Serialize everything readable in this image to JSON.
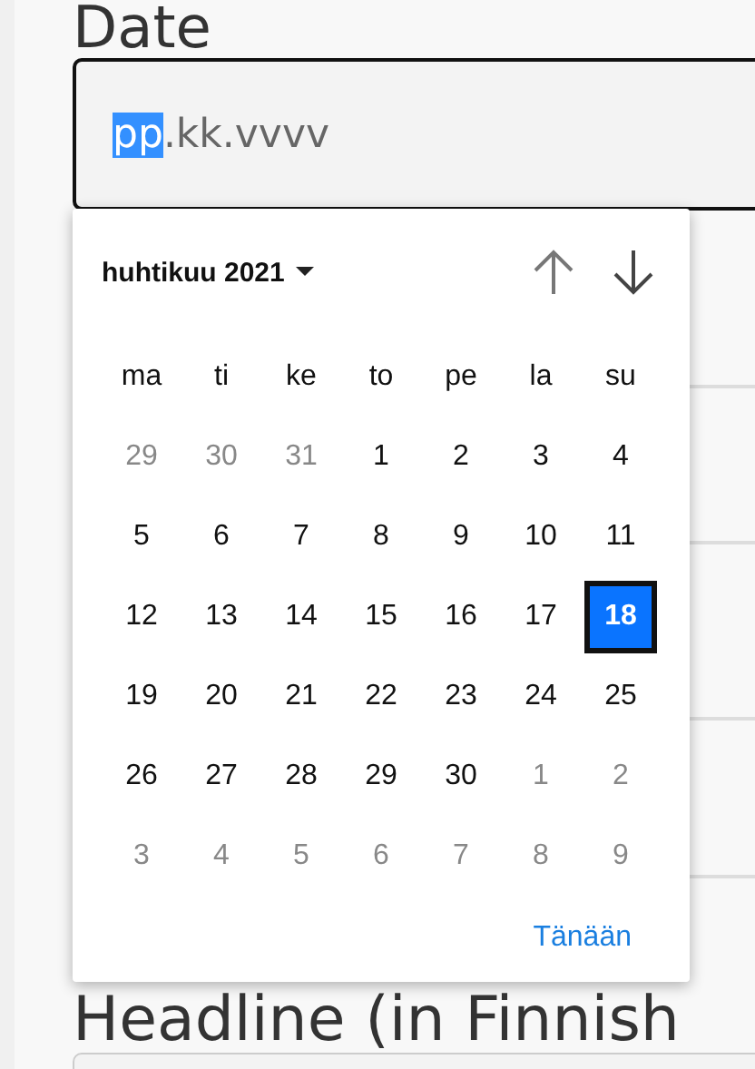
{
  "date_label": "Date",
  "date_field": {
    "segments": [
      {
        "text": "pp",
        "selected": true
      },
      {
        "text": ".kk.vvvv",
        "selected": false
      }
    ]
  },
  "calendar": {
    "month": "huhtikuu 2021",
    "weekdays": [
      "ma",
      "ti",
      "ke",
      "to",
      "pe",
      "la",
      "su"
    ],
    "weeks": [
      [
        {
          "label": "29",
          "muted": true,
          "selected": false
        },
        {
          "label": "30",
          "muted": true,
          "selected": false
        },
        {
          "label": "31",
          "muted": true,
          "selected": false
        },
        {
          "label": "1",
          "muted": false,
          "selected": false
        },
        {
          "label": "2",
          "muted": false,
          "selected": false
        },
        {
          "label": "3",
          "muted": false,
          "selected": false
        },
        {
          "label": "4",
          "muted": false,
          "selected": false
        }
      ],
      [
        {
          "label": "5",
          "muted": false,
          "selected": false
        },
        {
          "label": "6",
          "muted": false,
          "selected": false
        },
        {
          "label": "7",
          "muted": false,
          "selected": false
        },
        {
          "label": "8",
          "muted": false,
          "selected": false
        },
        {
          "label": "9",
          "muted": false,
          "selected": false
        },
        {
          "label": "10",
          "muted": false,
          "selected": false
        },
        {
          "label": "11",
          "muted": false,
          "selected": false
        }
      ],
      [
        {
          "label": "12",
          "muted": false,
          "selected": false
        },
        {
          "label": "13",
          "muted": false,
          "selected": false
        },
        {
          "label": "14",
          "muted": false,
          "selected": false
        },
        {
          "label": "15",
          "muted": false,
          "selected": false
        },
        {
          "label": "16",
          "muted": false,
          "selected": false
        },
        {
          "label": "17",
          "muted": false,
          "selected": false
        },
        {
          "label": "18",
          "muted": false,
          "selected": true
        }
      ],
      [
        {
          "label": "19",
          "muted": false,
          "selected": false
        },
        {
          "label": "20",
          "muted": false,
          "selected": false
        },
        {
          "label": "21",
          "muted": false,
          "selected": false
        },
        {
          "label": "22",
          "muted": false,
          "selected": false
        },
        {
          "label": "23",
          "muted": false,
          "selected": false
        },
        {
          "label": "24",
          "muted": false,
          "selected": false
        },
        {
          "label": "25",
          "muted": false,
          "selected": false
        }
      ],
      [
        {
          "label": "26",
          "muted": false,
          "selected": false
        },
        {
          "label": "27",
          "muted": false,
          "selected": false
        },
        {
          "label": "28",
          "muted": false,
          "selected": false
        },
        {
          "label": "29",
          "muted": false,
          "selected": false
        },
        {
          "label": "30",
          "muted": false,
          "selected": false
        },
        {
          "label": "1",
          "muted": true,
          "selected": false
        },
        {
          "label": "2",
          "muted": true,
          "selected": false
        }
      ],
      [
        {
          "label": "3",
          "muted": true,
          "selected": false
        },
        {
          "label": "4",
          "muted": true,
          "selected": false
        },
        {
          "label": "5",
          "muted": true,
          "selected": false
        },
        {
          "label": "6",
          "muted": true,
          "selected": false
        },
        {
          "label": "7",
          "muted": true,
          "selected": false
        },
        {
          "label": "8",
          "muted": true,
          "selected": false
        },
        {
          "label": "9",
          "muted": true,
          "selected": false
        }
      ]
    ],
    "today_button": "Tänään"
  },
  "headline_label": "Headline (in Finnish"
}
